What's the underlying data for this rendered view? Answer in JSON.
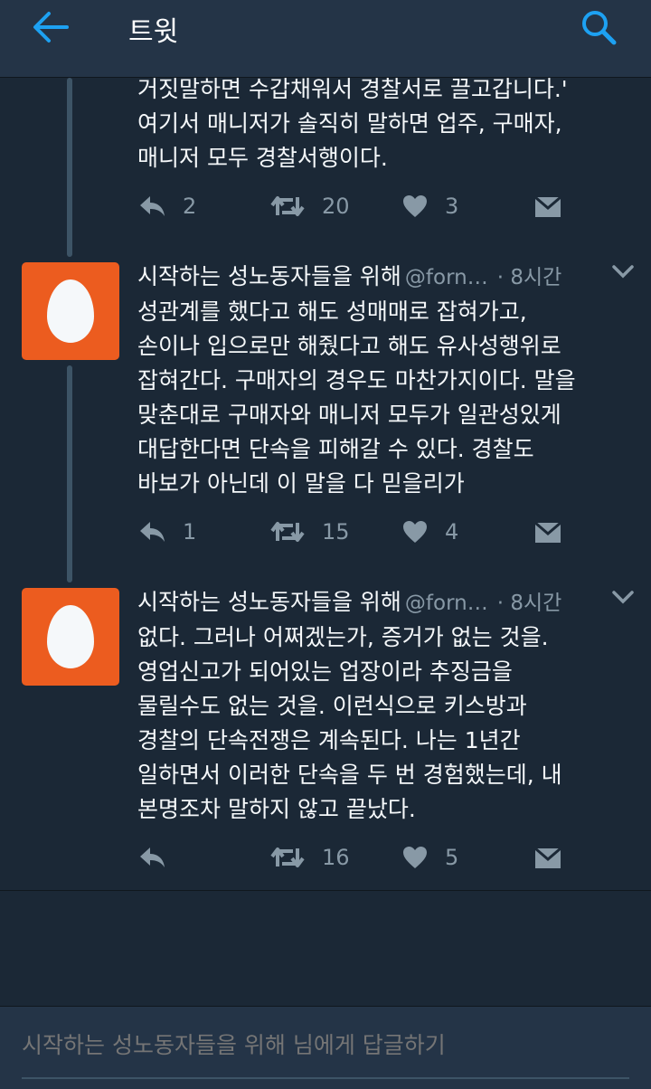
{
  "header": {
    "title": "트윗"
  },
  "colors": {
    "background": "#1b2836",
    "topbar": "#243447",
    "avatar": "#ec5c1f",
    "secondary_text": "#8899a6",
    "accent": "#1da1f2"
  },
  "icons": {
    "back": "arrow-left-icon",
    "search": "search-icon",
    "reply": "reply-icon",
    "retweet": "retweet-icon",
    "like": "heart-icon",
    "dm": "envelope-icon",
    "more": "chevron-down-icon"
  },
  "tweets": [
    {
      "lines": [
        "거짓말하면 수갑채워서 경찰서로 끌고갑니다.'",
        "여기서 매니저가 솔직히 말하면 업주, 구매자,",
        "매니저 모두 경찰서행이다."
      ],
      "replies": "2",
      "retweets": "20",
      "likes": "3"
    },
    {
      "name": "시작하는 성노동자들을 위해",
      "handle": "@forn…",
      "time": "· 8시간",
      "lines": [
        "성관계를 했다고 해도 성매매로 잡혀가고,",
        "손이나 입으로만 해줬다고 해도 유사성행위로",
        "잡혀간다. 구매자의 경우도 마찬가지이다. 말을",
        "맞춘대로 구매자와 매니저 모두가 일관성있게",
        "대답한다면 단속을 피해갈 수 있다. 경찰도",
        "바보가 아닌데 이 말을 다 믿을리가"
      ],
      "replies": "1",
      "retweets": "15",
      "likes": "4"
    },
    {
      "name": "시작하는 성노동자들을 위해",
      "handle": "@forn…",
      "time": "· 8시간",
      "lines": [
        "없다. 그러나 어쩌겠는가, 증거가 없는 것을.",
        "영업신고가 되어있는 업장이라 추징금을",
        "물릴수도 없는 것을. 이런식으로 키스방과",
        "경찰의 단속전쟁은 계속된다. 나는 1년간",
        "일하면서 이러한 단속을 두 번 경험했는데, 내",
        "본명조차 말하지 않고 끝났다."
      ],
      "replies": "",
      "retweets": "16",
      "likes": "5"
    }
  ],
  "reply_box": {
    "placeholder": "시작하는 성노동자들을 위해 님에게 답글하기"
  }
}
